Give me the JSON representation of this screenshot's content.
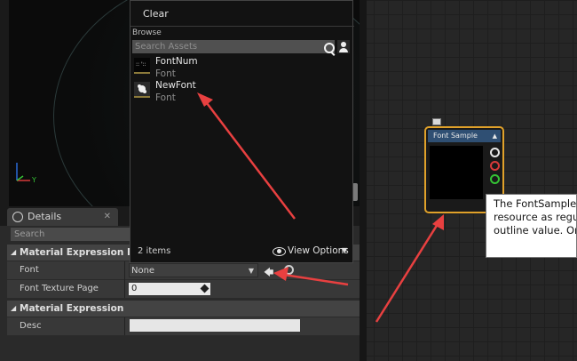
{
  "viewport": {
    "axis_label": "Y"
  },
  "picker": {
    "clear_label": "Clear",
    "browse_label": "Browse",
    "search_placeholder": "Search Assets",
    "assets": [
      {
        "name": "FontNum",
        "type": "Font"
      },
      {
        "name": "NewFont",
        "type": "Font"
      }
    ],
    "item_count": "2 items",
    "view_options_label": "View Options"
  },
  "details": {
    "tab_label": "Details",
    "search_placeholder": "Search",
    "sections": [
      {
        "title": "Material Expression Font S"
      },
      {
        "title": "Material Expression"
      }
    ],
    "font_label": "Font",
    "font_value": "None",
    "texture_page_label": "Font Texture Page",
    "texture_page_value": "0",
    "desc_label": "Desc"
  },
  "node": {
    "title": "Font Sample"
  },
  "tooltip": {
    "line1": "The FontSample",
    "line2": "resource as regu",
    "line3": "outline value. On"
  },
  "colors": {
    "node_border": "#e0a12a",
    "node_title": "#2f4f73",
    "arrow": "#e84040",
    "pin_white": "#e8e8e8",
    "pin_red": "#d83a3a",
    "pin_green": "#34c234"
  }
}
